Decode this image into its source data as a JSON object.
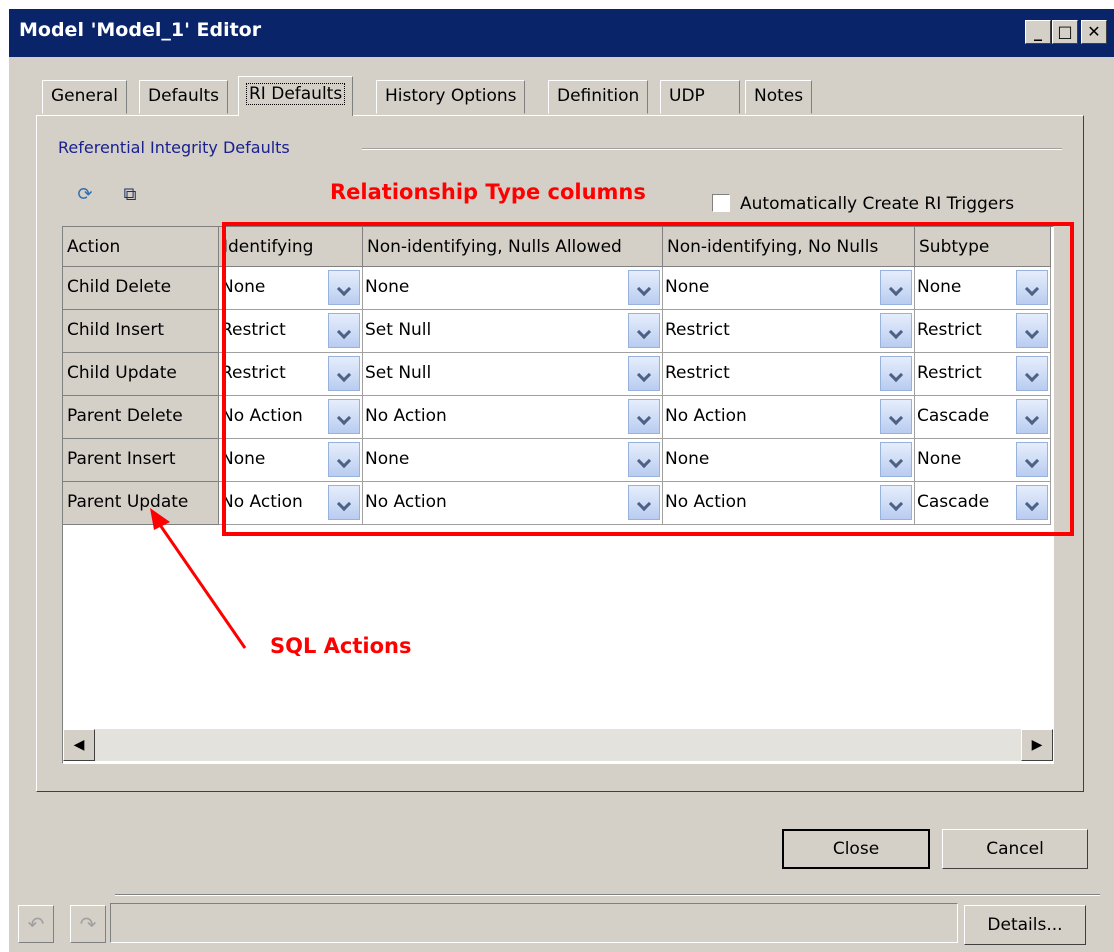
{
  "window": {
    "title": "Model 'Model_1' Editor"
  },
  "title_buttons": {
    "minimize": "_",
    "maximize": "□",
    "close": "✕"
  },
  "tabs": [
    {
      "label": "General"
    },
    {
      "label": "Defaults"
    },
    {
      "label": "RI Defaults",
      "active": true
    },
    {
      "label": "History Options"
    },
    {
      "label": "Definition"
    },
    {
      "label": "UDP"
    },
    {
      "label": "Notes"
    }
  ],
  "group": {
    "label": "Referential Integrity Defaults"
  },
  "toolbar": {
    "icons": [
      "refresh-icon",
      "options-icon"
    ]
  },
  "checkbox": {
    "label": "Automatically Create RI Triggers",
    "checked": false
  },
  "annotations": {
    "relationship_label": "Relationship Type columns",
    "sql_label": "SQL Actions",
    "color": "#ff0000"
  },
  "grid": {
    "headers": [
      "Action",
      "Identifying",
      "Non-identifying, Nulls Allowed",
      "Non-identifying, No Nulls",
      "Subtype"
    ],
    "rows": [
      {
        "action": "Child Delete",
        "values": [
          "None",
          "None",
          "None",
          "None"
        ]
      },
      {
        "action": "Child Insert",
        "values": [
          "Restrict",
          "Set Null",
          "Restrict",
          "Restrict"
        ]
      },
      {
        "action": "Child Update",
        "values": [
          "Restrict",
          "Set Null",
          "Restrict",
          "Restrict"
        ]
      },
      {
        "action": "Parent Delete",
        "values": [
          "No Action",
          "No Action",
          "No Action",
          "Cascade"
        ]
      },
      {
        "action": "Parent Insert",
        "values": [
          "None",
          "None",
          "None",
          "None"
        ]
      },
      {
        "action": "Parent Update",
        "values": [
          "No Action",
          "No Action",
          "No Action",
          "Cascade"
        ]
      }
    ],
    "scroll_left": "◀",
    "scroll_right": "▶"
  },
  "buttons": {
    "close": "Close",
    "cancel": "Cancel",
    "details": "Details..."
  },
  "status": {
    "text": ""
  }
}
